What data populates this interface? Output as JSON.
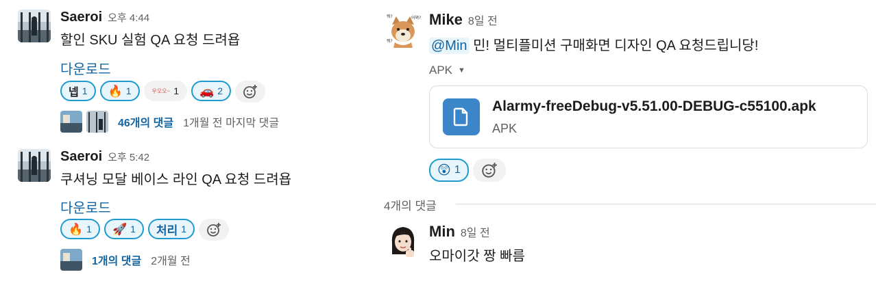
{
  "left": {
    "messages": [
      {
        "author": "Saeroi",
        "time": "오후 4:44",
        "text": "할인 SKU 실험 QA 요청 드려욥",
        "download_label": "다운로드",
        "reactions": [
          {
            "emoji": "넵",
            "count": "1",
            "icon": "neb-text-emoji"
          },
          {
            "emoji": "🔥",
            "count": "1",
            "icon": "fire-emoji"
          },
          {
            "emoji": "우오오~",
            "count": "1",
            "icon": "wooo-sticker-emoji"
          },
          {
            "emoji": "🚗",
            "count": "2",
            "icon": "car-emoji"
          }
        ],
        "reply_count": "46개의 댓글",
        "last_reply": "1개월 전 마지막 댓글"
      },
      {
        "author": "Saeroi",
        "time": "오후 5:42",
        "text": "쿠셔닝 모달 베이스 라인 QA 요청 드려욥",
        "download_label": "다운로드",
        "reactions": [
          {
            "emoji": "🔥",
            "count": "1",
            "icon": "fire-emoji"
          },
          {
            "emoji": "🚀",
            "count": "1",
            "icon": "rocket-emoji"
          },
          {
            "emoji": "처리",
            "count": "1",
            "icon": "cheori-text-emoji"
          }
        ],
        "reply_count": "1개의 댓글",
        "last_reply": "2개월 전"
      }
    ]
  },
  "right": {
    "message": {
      "author": "Mike",
      "time": "8일 전",
      "mention": "@Min",
      "text": " 민! 멀티플미션 구매화면 디자인 QA 요청드립니당!",
      "attachment_label": "APK",
      "file": {
        "name": "Alarmy-freeDebug-v5.51.00-DEBUG-c55100.apk",
        "type": "APK"
      },
      "reactions": [
        {
          "emoji": "😲",
          "count": "1",
          "icon": "hushed-face-emoji"
        }
      ]
    },
    "divider_label": "4개의 댓글",
    "reply": {
      "author": "Min",
      "time": "8일 전",
      "text": "오마이갓 짱 빠름"
    }
  },
  "colors": {
    "link": "#1264a3",
    "reaction_border": "#1d9bd1",
    "reaction_bg": "#e8f5fa",
    "file_icon_bg": "#3a86c8"
  }
}
